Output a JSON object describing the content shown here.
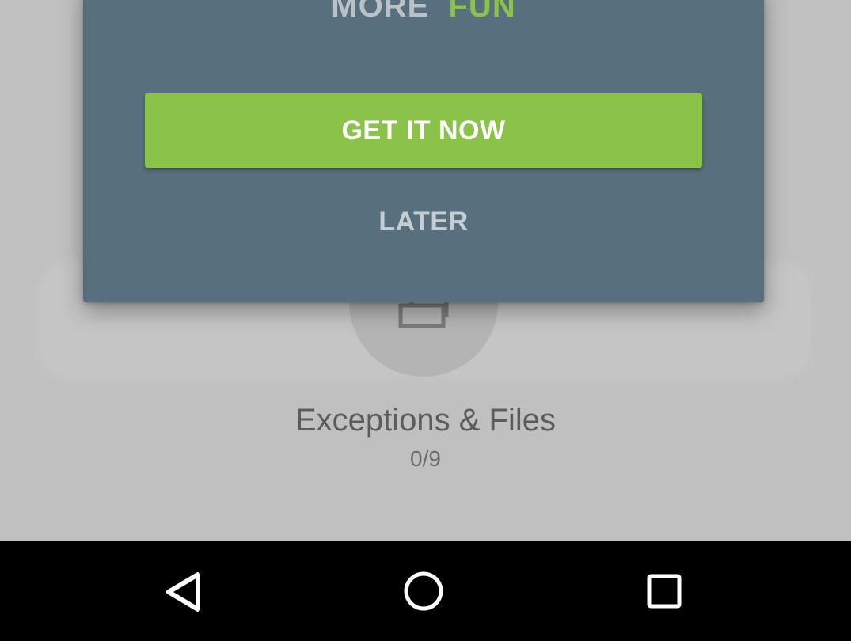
{
  "dialog": {
    "headline_word1": "MORE",
    "headline_word2": "FUN",
    "primary_label": "GET IT NOW",
    "secondary_label": "LATER"
  },
  "background": {
    "category_icon": "files-icon",
    "category_title": "Exceptions & Files",
    "category_count": "0/9"
  },
  "navbar": {
    "back_icon": "back-triangle-icon",
    "home_icon": "home-circle-icon",
    "recents_icon": "recents-square-icon"
  },
  "colors": {
    "accent": "#8bc34a",
    "dialog_bg": "#58707d",
    "scrim_bg": "#c0c0c0",
    "navbar_bg": "#000000"
  }
}
